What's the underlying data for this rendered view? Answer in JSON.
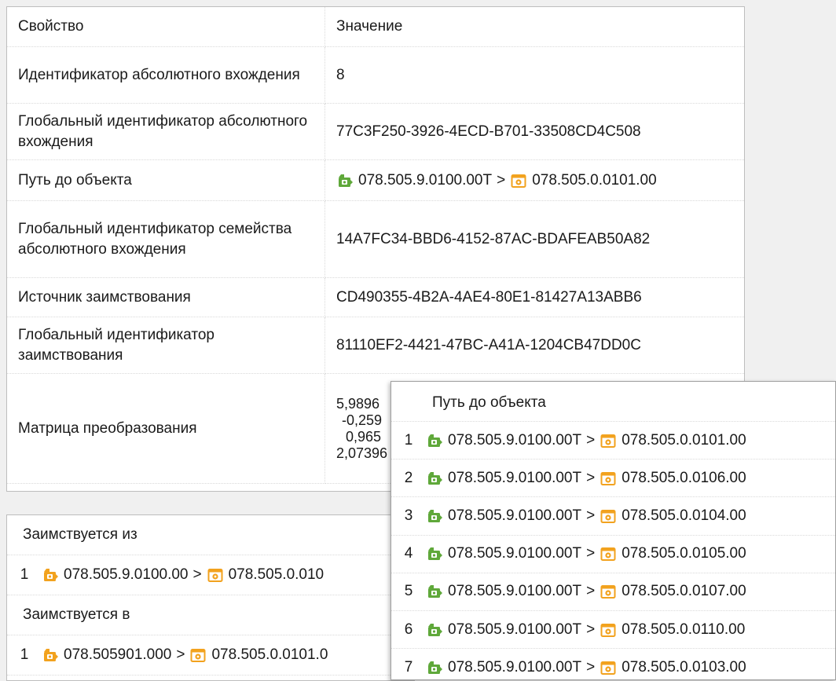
{
  "properties": {
    "header": {
      "property": "Свойство",
      "value": "Значение"
    },
    "rows": [
      {
        "name": "Идентификатор абсолютного вхождения",
        "value": "8"
      },
      {
        "name": "Глобальный идентификатор абсолютного вхождения",
        "value": "77C3F250-3926-4ECD-B701-33508CD4C508"
      },
      {
        "name": "Путь до объекта",
        "path": {
          "from": "078.505.9.0100.00T",
          "sep": ">",
          "to": "078.505.0.0101.00"
        }
      },
      {
        "name": "Глобальный идентификатор семейства абсолютного вхождения",
        "value": "14A7FC34-BBD6-4152-87AC-BDAFEAB50A82"
      },
      {
        "name": "Источник заимствования",
        "value": "CD490355-4B2A-4AE4-80E1-81427A13ABB6"
      },
      {
        "name": "Глобальный идентификатор заимствования",
        "value": "81110EF2-4421-47BC-A41A-1204CB47DD0C"
      },
      {
        "name": "Матрица преобразования",
        "matrix": [
          "5,9896",
          "-0,259",
          "0,965",
          "2,07396"
        ]
      }
    ]
  },
  "borrow": {
    "from_label": "Заимствуется из",
    "from_items": [
      {
        "num": "1",
        "from": "078.505.9.0100.00",
        "sep": ">",
        "to": "078.505.0.010"
      }
    ],
    "to_label": "Заимствуется в",
    "to_items": [
      {
        "num": "1",
        "from": "078.505901.000",
        "sep": ">",
        "to": "078.505.0.0101.0"
      }
    ]
  },
  "path_popup": {
    "title": "Путь до объекта",
    "items": [
      {
        "num": "1",
        "from": "078.505.9.0100.00T",
        "sep": ">",
        "to": "078.505.0.0101.00"
      },
      {
        "num": "2",
        "from": "078.505.9.0100.00T",
        "sep": ">",
        "to": "078.505.0.0106.00"
      },
      {
        "num": "3",
        "from": "078.505.9.0100.00T",
        "sep": ">",
        "to": "078.505.0.0104.00"
      },
      {
        "num": "4",
        "from": "078.505.9.0100.00T",
        "sep": ">",
        "to": "078.505.0.0105.00"
      },
      {
        "num": "5",
        "from": "078.505.9.0100.00T",
        "sep": ">",
        "to": "078.505.0.0107.00"
      },
      {
        "num": "6",
        "from": "078.505.9.0100.00T",
        "sep": ">",
        "to": "078.505.0.0110.00"
      },
      {
        "num": "7",
        "from": "078.505.9.0100.00T",
        "sep": ">",
        "to": "078.505.0.0103.00"
      }
    ]
  },
  "icons": {
    "green_assembly": "green-assembly-icon",
    "orange_assembly": "orange-assembly-icon",
    "orange_part": "orange-part-icon"
  },
  "colors": {
    "green": "#5fa83a",
    "orange": "#f2a21e"
  }
}
